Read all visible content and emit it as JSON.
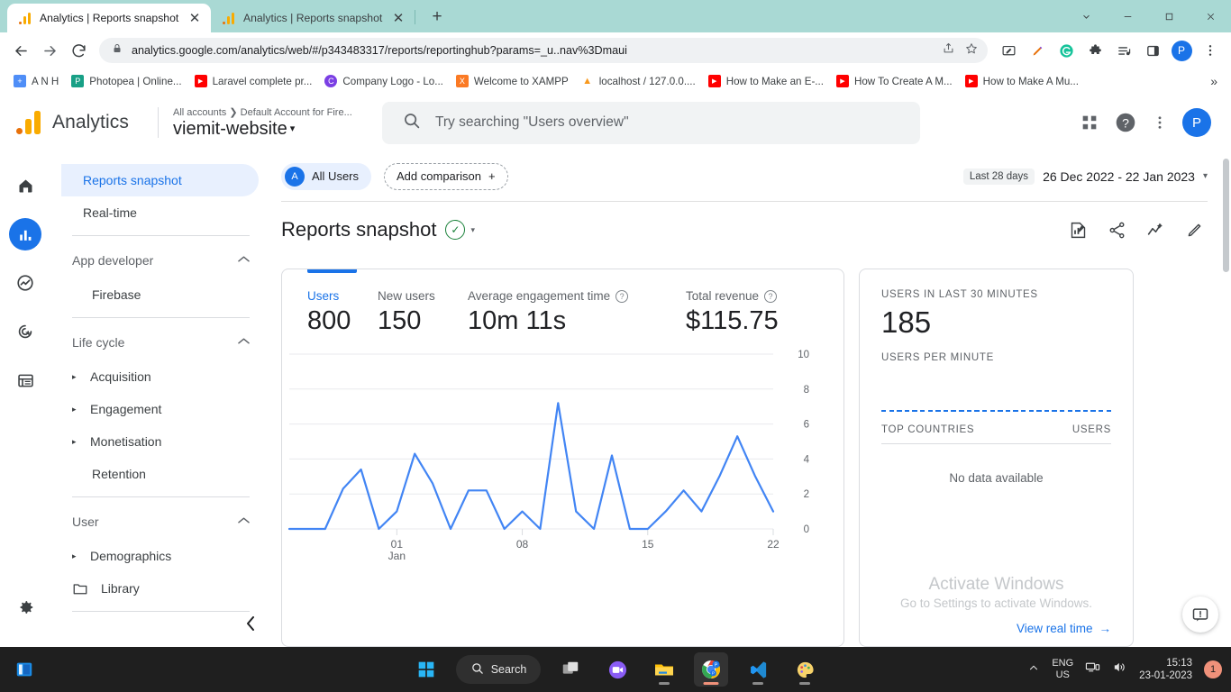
{
  "browser": {
    "tabs": [
      {
        "title": "Analytics | Reports snapshot",
        "favicon": "google-analytics-icon",
        "active": true
      },
      {
        "title": "Analytics | Reports snapshot",
        "favicon": "google-analytics-icon",
        "active": false
      }
    ],
    "new_tab_label": "+",
    "window_controls": {
      "minimize": "−",
      "maximize": "❐",
      "close": "✕",
      "chevron": "⌄"
    },
    "nav": {
      "back": "←",
      "forward": "→",
      "reload": "↻"
    },
    "url": "analytics.google.com/analytics/web/#/p343483317/reports/reportinghub?params=_u..nav%3Dmaui",
    "lock_icon": "lock-icon",
    "profile_initial": "P",
    "bookmarks": [
      {
        "label": "A N H",
        "icon_color": "#4f8ef7",
        "glyph": "+"
      },
      {
        "label": "Photopea | Online...",
        "icon_color": "#18a086",
        "glyph": "P"
      },
      {
        "label": "Laravel complete pr...",
        "icon_color": "#ff0000",
        "glyph": "▶"
      },
      {
        "label": "Company Logo - Lo...",
        "icon_color": "#7b3fe4",
        "glyph": "C"
      },
      {
        "label": "Welcome to XAMPP",
        "icon_color": "#fb7a24",
        "glyph": "X"
      },
      {
        "label": "localhost / 127.0.0....",
        "icon_color": "#f2f2f2",
        "glyph": "⛰"
      },
      {
        "label": "How to Make an E-...",
        "icon_color": "#ff0000",
        "glyph": "▶"
      },
      {
        "label": "How To Create A M...",
        "icon_color": "#ff0000",
        "glyph": "▶"
      },
      {
        "label": "How to Make A Mu...",
        "icon_color": "#ff0000",
        "glyph": "▶"
      }
    ],
    "bookmarks_overflow": "»"
  },
  "ga_header": {
    "product_name": "Analytics",
    "account_breadcrumb": "All accounts ❯ Default Account for Fire...",
    "property_name": "viemit-website",
    "property_caret": "▾",
    "search_placeholder": "Try searching \"Users overview\"",
    "icons": {
      "apps": "apps-grid-icon",
      "help": "help-icon",
      "more": "more-vertical-icon"
    },
    "avatar_initial": "P"
  },
  "rail": [
    {
      "name": "home-icon",
      "active": false
    },
    {
      "name": "reports-icon",
      "active": true
    },
    {
      "name": "explore-icon",
      "active": false
    },
    {
      "name": "advertising-icon",
      "active": false
    },
    {
      "name": "configure-icon",
      "active": false
    },
    {
      "name": "settings-gear-icon",
      "active": false
    }
  ],
  "sidebar": {
    "items": [
      {
        "label": "Reports snapshot",
        "type": "item",
        "selected": true
      },
      {
        "label": "Real-time",
        "type": "item",
        "selected": false
      },
      {
        "type": "separator"
      },
      {
        "label": "App developer",
        "type": "group",
        "chevron": "⌃"
      },
      {
        "label": "Firebase",
        "type": "sub"
      },
      {
        "type": "separator"
      },
      {
        "label": "Life cycle",
        "type": "group",
        "chevron": "⌃"
      },
      {
        "label": "Acquisition",
        "type": "expandable",
        "arrow": "▸"
      },
      {
        "label": "Engagement",
        "type": "expandable",
        "arrow": "▸"
      },
      {
        "label": "Monetisation",
        "type": "expandable",
        "arrow": "▸"
      },
      {
        "label": "Retention",
        "type": "sub"
      },
      {
        "type": "separator"
      },
      {
        "label": "User",
        "type": "group",
        "chevron": "⌃"
      },
      {
        "label": "Demographics",
        "type": "expandable",
        "arrow": "▸"
      },
      {
        "label": "Library",
        "type": "library",
        "icon": "folder-icon"
      },
      {
        "type": "separator"
      }
    ],
    "collapse_icon": "‹"
  },
  "controls": {
    "audience_label": "All Users",
    "audience_initial": "A",
    "add_comparison_label": "Add comparison",
    "add_comparison_plus": "+",
    "date_preset": "Last 28 days",
    "date_range": "26 Dec 2022 - 22 Jan 2023",
    "date_caret": "▾"
  },
  "page": {
    "title": "Reports snapshot",
    "status_badge": "check-circle-icon",
    "badge_caret": "▾",
    "actions": [
      {
        "name": "insights-icon"
      },
      {
        "name": "share-icon"
      },
      {
        "name": "compare-icon"
      },
      {
        "name": "edit-pencil-icon"
      }
    ]
  },
  "metrics": [
    {
      "label": "Users",
      "value": "800",
      "selected": true,
      "help": false
    },
    {
      "label": "New users",
      "value": "150",
      "selected": false,
      "help": false
    },
    {
      "label": "Average engagement time",
      "value": "10m 11s",
      "selected": false,
      "help": true
    },
    {
      "label": "Total revenue",
      "value": "$115.75",
      "selected": false,
      "help": true
    }
  ],
  "realtime": {
    "users_caption": "USERS IN LAST 30 MINUTES",
    "users_value": "185",
    "per_minute_caption": "USERS PER MINUTE",
    "table_header_left": "TOP COUNTRIES",
    "table_header_right": "USERS",
    "no_data": "No data available",
    "view_real_time": "View real time",
    "view_real_time_arrow": "→"
  },
  "watermark": {
    "title": "Activate Windows",
    "subtitle": "Go to Settings to activate Windows."
  },
  "feedback_icon": "feedback-icon",
  "taskbar": {
    "widgets_icon": "widgets-icon",
    "start_icon": "windows-start-icon",
    "search_label": "Search",
    "apps": [
      {
        "name": "task-view-icon",
        "running": false,
        "active": false
      },
      {
        "name": "google-meet-icon",
        "running": false,
        "active": false
      },
      {
        "name": "file-explorer-icon",
        "running": true,
        "active": false
      },
      {
        "name": "google-chrome-icon",
        "running": true,
        "active": true
      },
      {
        "name": "vs-code-icon",
        "running": true,
        "active": false
      },
      {
        "name": "paint-icon",
        "running": true,
        "active": false
      }
    ],
    "chevron": "⌃",
    "lang_line1": "ENG",
    "lang_line2": "US",
    "network_icon": "network-icon",
    "volume_icon": "volume-icon",
    "time": "15:13",
    "date": "23-01-2023",
    "notification_count": "1"
  },
  "chart_data": {
    "type": "line",
    "title": "Users over time",
    "xlabel": "Jan",
    "ylabel": "",
    "ylim": [
      0,
      10
    ],
    "yticks": [
      0,
      2,
      4,
      6,
      8,
      10
    ],
    "xticks": [
      "01",
      "08",
      "15",
      "22"
    ],
    "xtick_sublabel": "Jan",
    "grid": true,
    "legend": false,
    "series_color": "#4285f4",
    "x": [
      "26 Dec",
      "27 Dec",
      "28 Dec",
      "29 Dec",
      "30 Dec",
      "31 Dec",
      "01 Jan",
      "02 Jan",
      "03 Jan",
      "04 Jan",
      "05 Jan",
      "06 Jan",
      "07 Jan",
      "08 Jan",
      "09 Jan",
      "10 Jan",
      "11 Jan",
      "12 Jan",
      "13 Jan",
      "14 Jan",
      "15 Jan",
      "16 Jan",
      "17 Jan",
      "18 Jan",
      "19 Jan",
      "20 Jan",
      "21 Jan",
      "22 Jan"
    ],
    "values": [
      0,
      0,
      0,
      2.3,
      3.4,
      0,
      1,
      4.3,
      2.6,
      0,
      2.2,
      2.2,
      0,
      1,
      0,
      7.2,
      1,
      0,
      4.2,
      0,
      0,
      1,
      2.2,
      1,
      3,
      5.3,
      3,
      1
    ]
  }
}
